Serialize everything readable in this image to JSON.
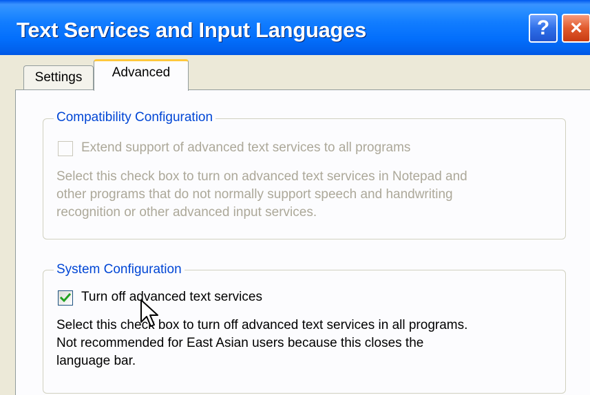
{
  "window": {
    "title": "Text Services and Input Languages",
    "help_glyph": "?",
    "close_glyph": "×"
  },
  "tabs": [
    {
      "label": "Settings",
      "selected": false
    },
    {
      "label": "Advanced",
      "selected": true
    }
  ],
  "compatibility": {
    "legend": "Compatibility Configuration",
    "checkbox_label": "Extend support of advanced text services to all programs",
    "checked": false,
    "enabled": false,
    "description": [
      "Select this check box to turn on advanced text services in Notepad and",
      "other programs that do not normally support speech and handwriting",
      "recognition or other advanced input services."
    ]
  },
  "system": {
    "legend": "System Configuration",
    "checkbox_label": "Turn off advanced text services",
    "checked": true,
    "enabled": true,
    "description": [
      "Select this check box to turn off advanced text services in all programs.",
      "Not recommended for East Asian users because this closes the",
      "language bar."
    ]
  },
  "colors": {
    "title_bar": "#0a5cf0",
    "group_legend": "#0046d5",
    "disabled_text": "#aca899",
    "check_mark": "#21a121",
    "tab_highlight": "#ffc83c"
  },
  "icons": {
    "help": "help-icon",
    "close": "close-icon",
    "check": "check-mark-icon",
    "cursor": "mouse-pointer-icon"
  }
}
